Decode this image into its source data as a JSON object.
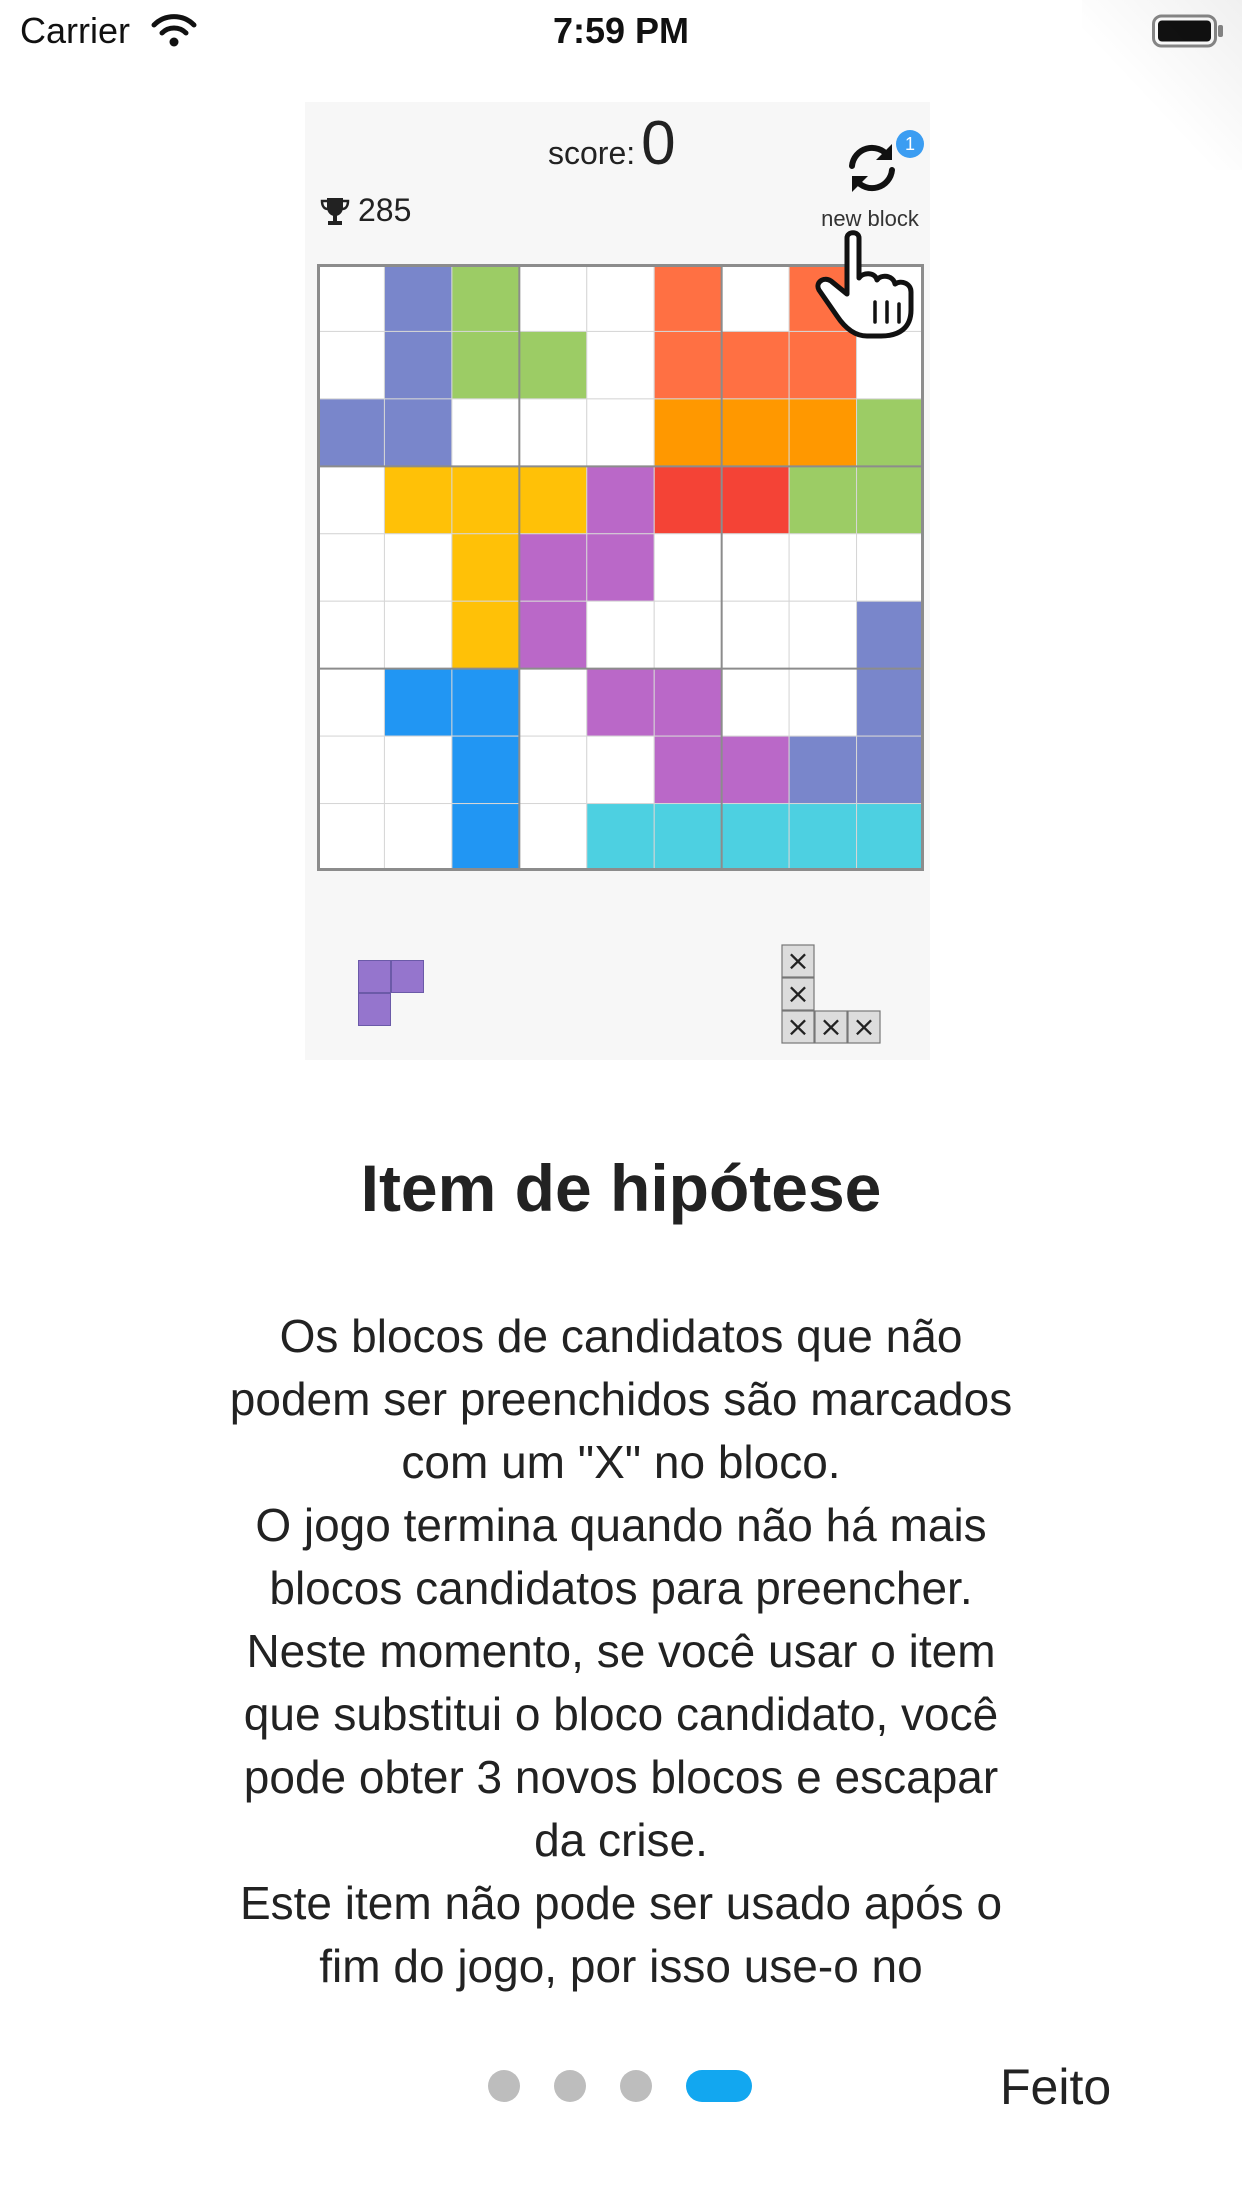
{
  "status_bar": {
    "carrier": "Carrier",
    "time": "7:59 PM"
  },
  "game": {
    "score_label": "score:",
    "score_value": "0",
    "best_score": "285",
    "new_block_label": "new block",
    "new_block_badge": "1",
    "colors": {
      "P": "#7986CB",
      "G": "#9CCC65",
      "O": "#FF7043",
      "A": "#FF9800",
      "Y": "#FFC107",
      "R": "#F44336",
      "V": "#BA68C8",
      "B": "#2196F3",
      "C": "#4DD0E1"
    },
    "board": [
      ".PG..O.O.",
      ".PGG.OOO.",
      "PP...AAAG",
      ".YYYVRRGG",
      "..YVV....",
      "..YV....P",
      ".BB.VV..P",
      "..B..VVPP",
      "..B.CCCCC"
    ],
    "candidate_piece_color": "#9575CD",
    "blocked_piece_mark": "×"
  },
  "tutorial": {
    "title": "Item de hipótese",
    "lines": [
      "Os blocos de candidatos que não",
      "podem ser preenchidos são marcados",
      "com um \"X\" no bloco.",
      "O jogo termina quando não há mais",
      "blocos candidatos para preencher.",
      "Neste momento, se você usar o item",
      "que substitui o bloco candidato, você",
      "pode obter 3 novos blocos e escapar",
      "da crise.",
      "Este item não pode ser usado após o",
      "fim do jogo, por isso use-o no"
    ],
    "page_count": 4,
    "active_page": 4,
    "done_label": "Feito"
  }
}
